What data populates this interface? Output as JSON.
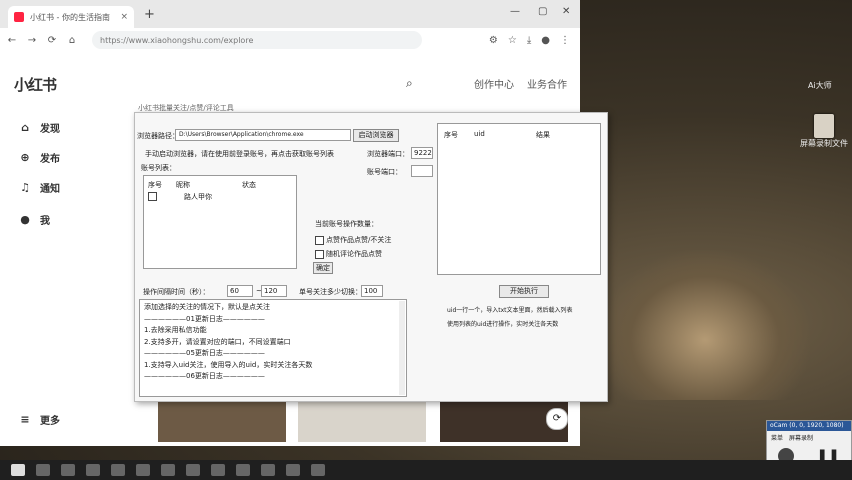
{
  "browser": {
    "tab_title": "小红书 - 你的生活指南",
    "url": "https://www.xiaohongshu.com/explore",
    "new_tab": "+",
    "close_tab": "×"
  },
  "xhs": {
    "logo": "小红书",
    "creator_center": "创作中心",
    "business": "业务合作",
    "nav": [
      {
        "label": "发现"
      },
      {
        "label": "发布"
      },
      {
        "label": "通知"
      },
      {
        "label": "我"
      }
    ],
    "more": "更多"
  },
  "tool": {
    "title_hint": "小红书批量关注/点赞/评论工具",
    "browser_path_label": "浏览器路径：",
    "browser_path_value": "D:\\Users\\Browser\\Application\\chrome.exe",
    "start_browser": "启动浏览器",
    "browser_note": "手动启动浏览器，请在使用前登录账号，再点击获取账号列表",
    "browser_port_label": "浏览器端口：",
    "browser_port_value": "9222",
    "account_port_label": "账号端口：",
    "account_list_label": "账号列表：",
    "account_columns": [
      "序号",
      "昵称",
      "状态"
    ],
    "account_rows": [
      {
        "nickname": "路人甲你"
      }
    ],
    "op_heading": "当前账号操作数量：",
    "opt_like": "点赞作品点赞/不关注",
    "opt_comment": "随机评论作品点赞",
    "confirm": "确定",
    "interval_label": "操作间隔时间（秒）：",
    "interval_min": "60",
    "interval_sep": "~",
    "interval_max": "120",
    "per_account_label": "单号关注多少切换：",
    "per_account_value": "100",
    "start_btn": "开始执行",
    "right_columns": [
      "序号",
      "uid",
      "结果"
    ],
    "right_note_1": "uid一行一个，导入txt文本里面，然后载入列表",
    "right_note_2": "使用列表的uid进行操作，实时关注各天数",
    "log": [
      "添加选择的关注的情况下，默认是点关注",
      "——————01更新日志——————",
      "1.去除采用私信功能",
      "2.支持多开，请设置对应的端口，不同设置端口",
      "——————05更新日志——————",
      "1.支持导入uid关注，使用导入的uid，实时关注各天数",
      "——————06更新日志——————"
    ]
  },
  "desktop": {
    "icon1": "Ai大师",
    "icon2": "屏幕录制文件"
  },
  "recorder": {
    "title": "oCam (0, 0, 1920, 1080)",
    "menu": "菜单",
    "capture": "屏幕录制",
    "pause": "停止",
    "stop": "停止"
  }
}
